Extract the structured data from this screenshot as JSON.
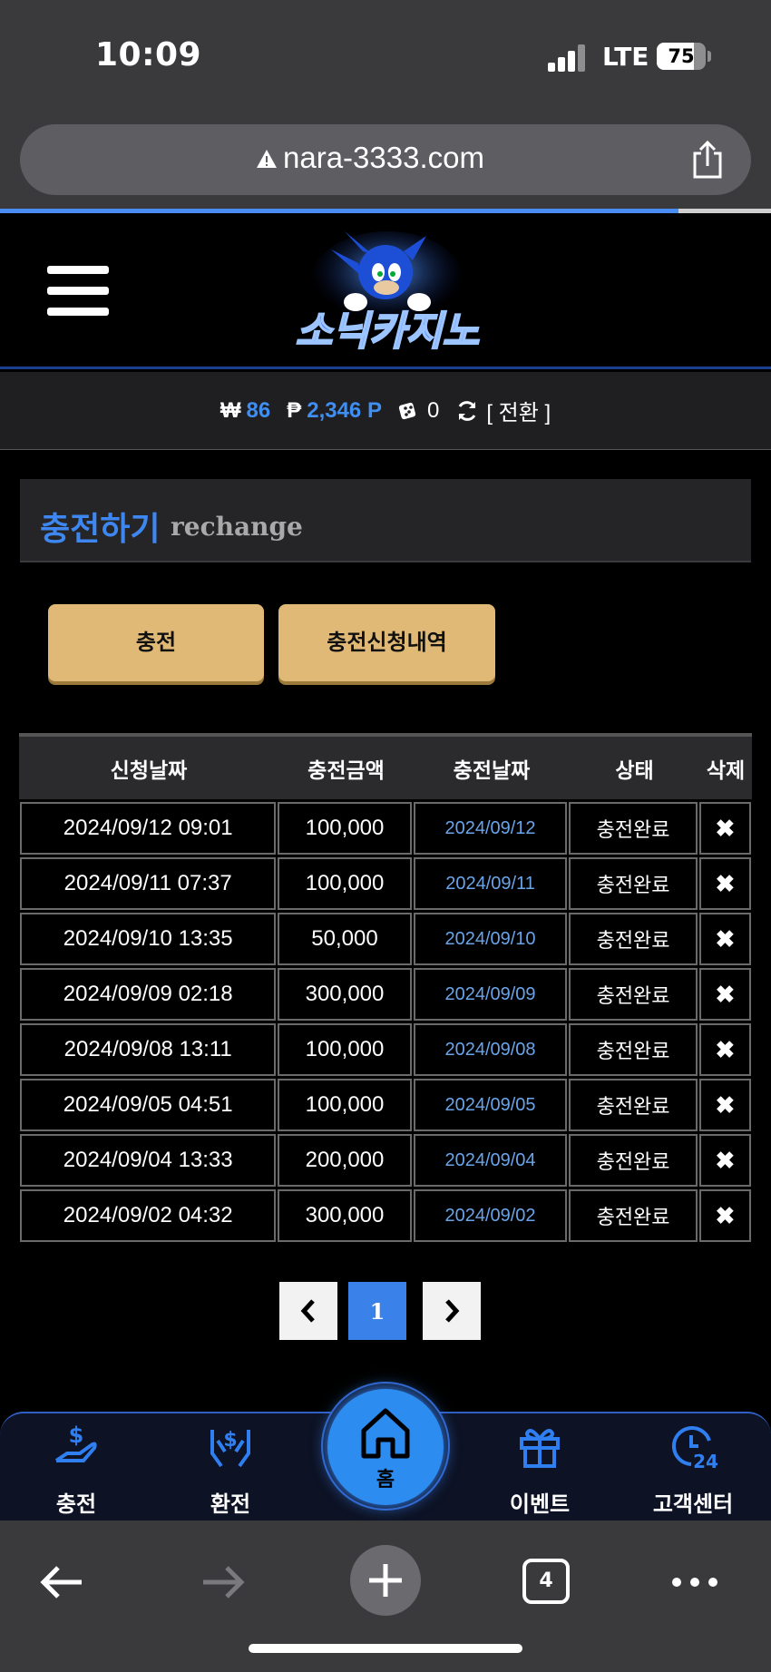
{
  "status_bar": {
    "time": "10:09",
    "network": "LTE",
    "battery": "75",
    "battery_level": 0.75
  },
  "browser": {
    "url": "nara-3333.com",
    "tab_count": "4",
    "load_progress": 0.88
  },
  "site": {
    "logo_text": "소닉카지노"
  },
  "balance": {
    "won_symbol": "₩",
    "won_value": "86",
    "point_symbol": "₱",
    "point_value": "2,346 P",
    "chip_value": "0",
    "convert_label": "[ 전환 ]"
  },
  "section": {
    "title_ko": "충전하기",
    "title_en": "rechange"
  },
  "buttons": {
    "charge": "충전",
    "history": "충전신청내역"
  },
  "table": {
    "headers": [
      "신청날짜",
      "충전금액",
      "충전날짜",
      "상태",
      "삭제"
    ],
    "rows": [
      {
        "request_date": "2024/09/12 09:01",
        "amount": "100,000",
        "charge_date": "2024/09/12",
        "status": "충전완료"
      },
      {
        "request_date": "2024/09/11 07:37",
        "amount": "100,000",
        "charge_date": "2024/09/11",
        "status": "충전완료"
      },
      {
        "request_date": "2024/09/10 13:35",
        "amount": "50,000",
        "charge_date": "2024/09/10",
        "status": "충전완료"
      },
      {
        "request_date": "2024/09/09 02:18",
        "amount": "300,000",
        "charge_date": "2024/09/09",
        "status": "충전완료"
      },
      {
        "request_date": "2024/09/08 13:11",
        "amount": "100,000",
        "charge_date": "2024/09/08",
        "status": "충전완료"
      },
      {
        "request_date": "2024/09/05 04:51",
        "amount": "100,000",
        "charge_date": "2024/09/05",
        "status": "충전완료"
      },
      {
        "request_date": "2024/09/04 13:33",
        "amount": "200,000",
        "charge_date": "2024/09/04",
        "status": "충전완료"
      },
      {
        "request_date": "2024/09/02 04:32",
        "amount": "300,000",
        "charge_date": "2024/09/02",
        "status": "충전완료"
      }
    ],
    "delete_glyph": "✖"
  },
  "pagination": {
    "current": "1"
  },
  "bottom_nav": {
    "charge": "충전",
    "exchange": "환전",
    "home": "홈",
    "event": "이벤트",
    "support": "고객센터"
  },
  "colors": {
    "accent": "#3e86f0",
    "button": "#e0b976",
    "nav_bg": "#0d1224"
  }
}
